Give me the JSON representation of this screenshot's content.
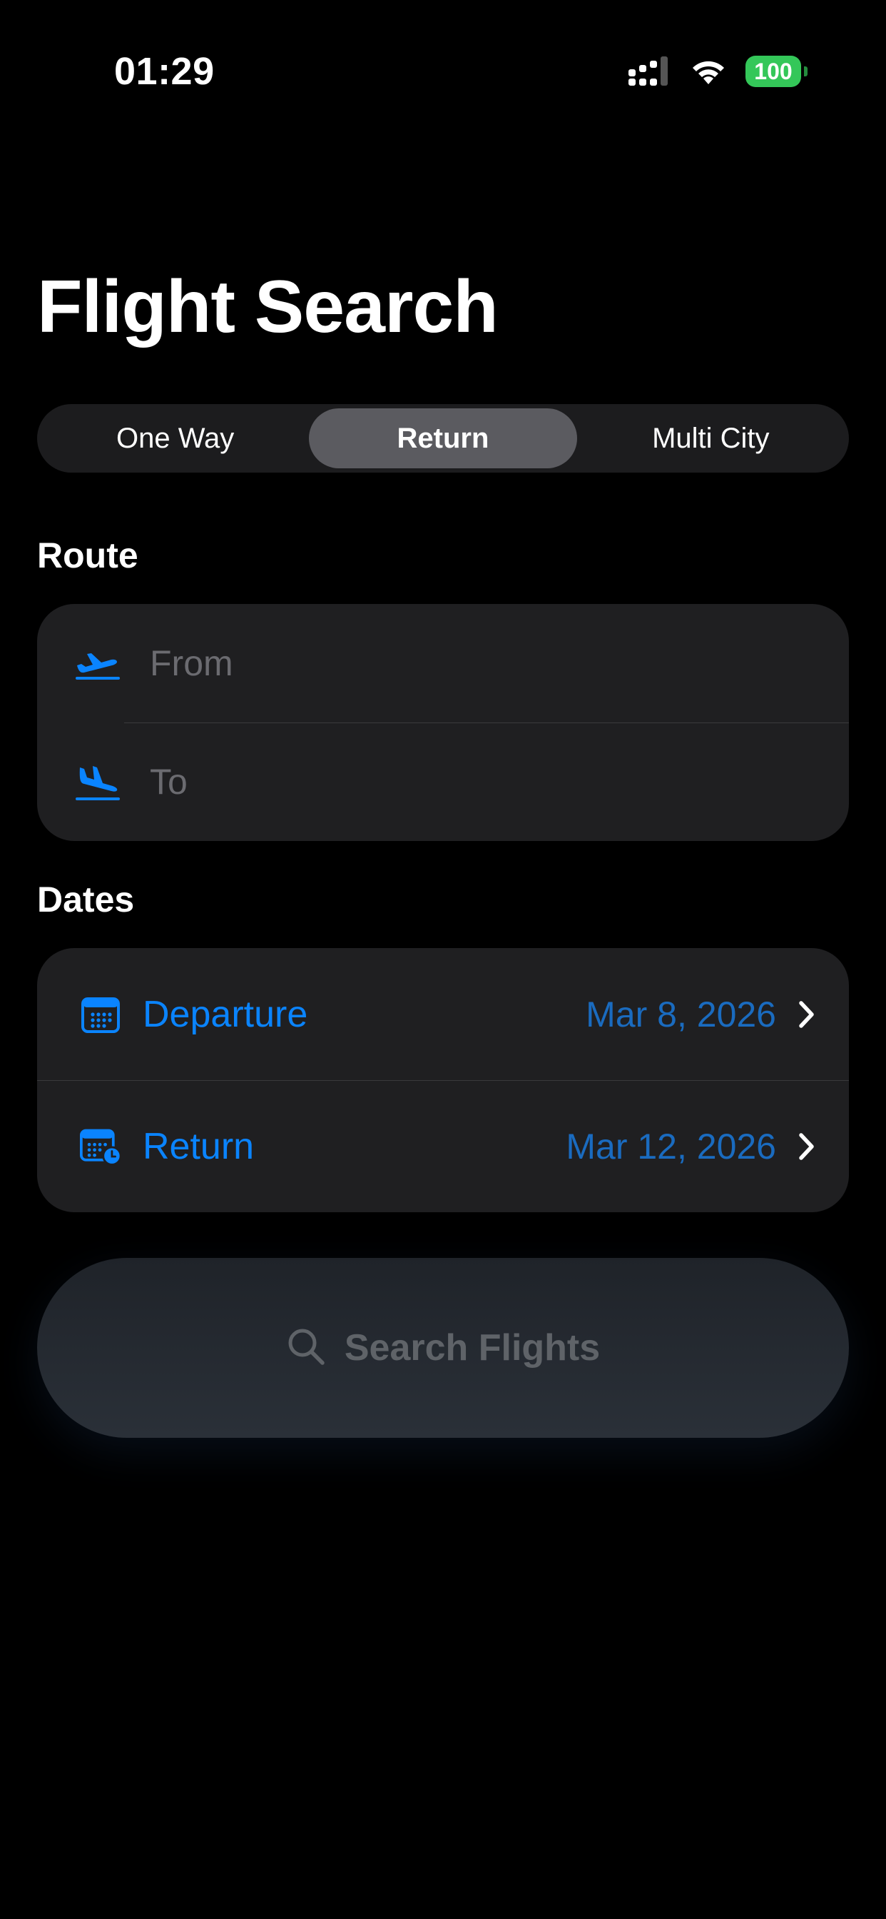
{
  "status_bar": {
    "time": "01:29",
    "battery": "100"
  },
  "header": {
    "title": "Flight Search"
  },
  "trip_type": {
    "options": [
      "One Way",
      "Return",
      "Multi City"
    ],
    "selected": "Return"
  },
  "route": {
    "section_label": "Route",
    "from_placeholder": "From",
    "to_placeholder": "To"
  },
  "dates": {
    "section_label": "Dates",
    "departure_label": "Departure",
    "departure_value": "Mar 8, 2026",
    "return_label": "Return",
    "return_value": "Mar 12, 2026"
  },
  "search_button": {
    "label": "Search Flights"
  },
  "colors": {
    "accent": "#0a84ff",
    "background": "#000000",
    "card": "#1f1f21",
    "battery": "#34c759"
  },
  "icons": [
    "signal-icon",
    "wifi-icon",
    "battery-icon",
    "airplane-departure-icon",
    "airplane-arrival-icon",
    "calendar-icon",
    "calendar-clock-icon",
    "chevron-right-icon",
    "search-icon"
  ]
}
